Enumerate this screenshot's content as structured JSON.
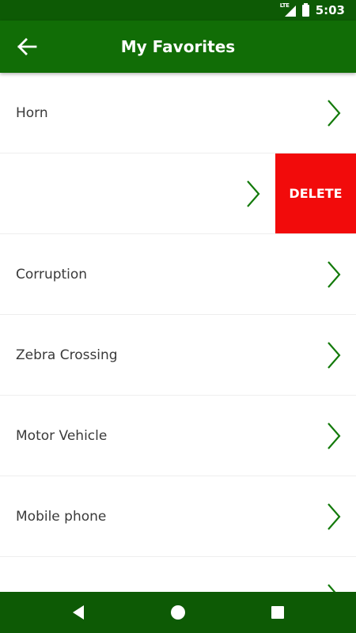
{
  "status_bar": {
    "network": "LTE",
    "time": "5:03"
  },
  "app_bar": {
    "title": "My Favorites",
    "back_icon": "arrow-left-icon"
  },
  "favorites": [
    {
      "label": "Horn",
      "swiped": false
    },
    {
      "label": "",
      "swiped": true,
      "action_label": "DELETE"
    },
    {
      "label": "Corruption",
      "swiped": false
    },
    {
      "label": "Zebra Crossing",
      "swiped": false
    },
    {
      "label": "Motor Vehicle",
      "swiped": false
    },
    {
      "label": "Mobile phone",
      "swiped": false
    },
    {
      "label": "",
      "swiped": false
    }
  ],
  "nav_bar": {
    "back_icon": "triangle-back-icon",
    "home_icon": "circle-home-icon",
    "recents_icon": "square-recents-icon"
  },
  "colors": {
    "status_bar": "#0d5a05",
    "app_bar": "#116d06",
    "chevron": "#137a0b",
    "delete": "#f20b0b"
  }
}
